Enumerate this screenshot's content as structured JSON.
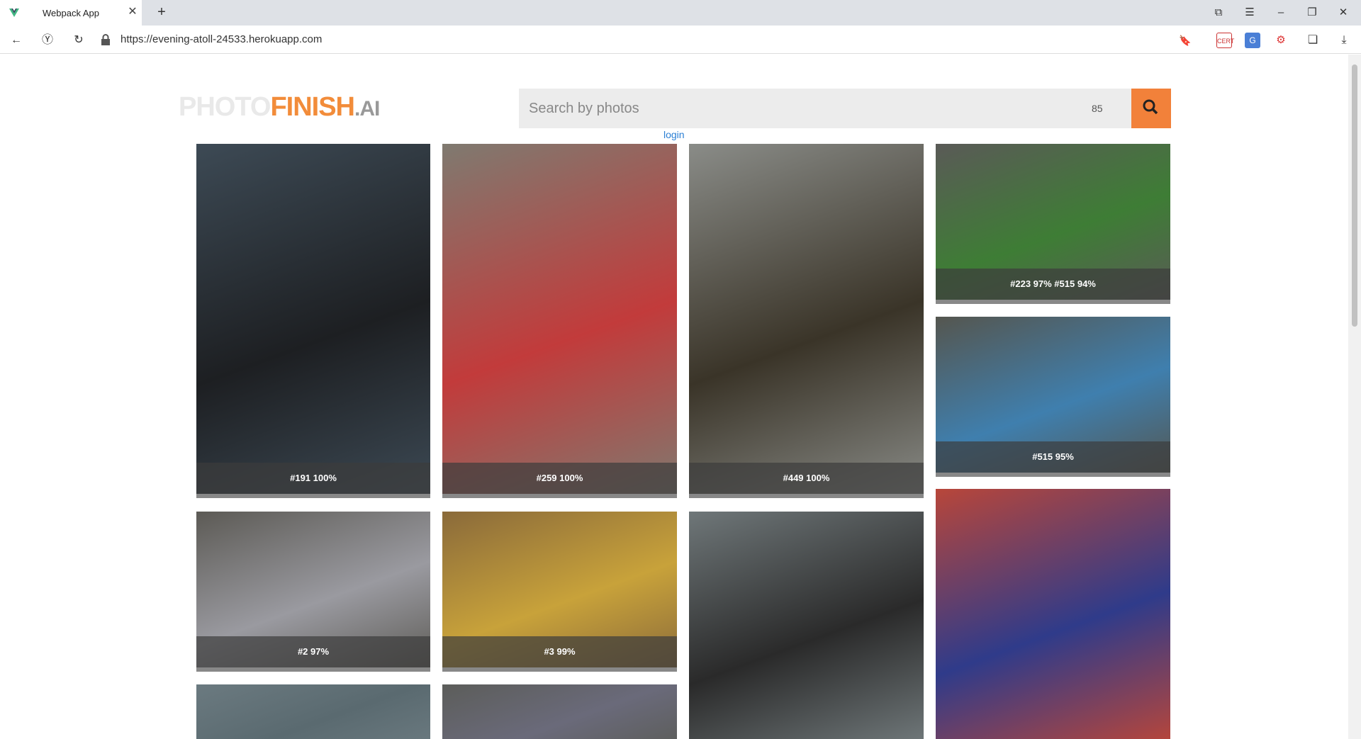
{
  "browser": {
    "tab_title": "Webpack App",
    "url": "https://evening-atoll-24533.herokuapp.com",
    "ext_label_1": "CERT"
  },
  "header": {
    "logo_photo": "PHOTO",
    "logo_finish": "FINISH",
    "logo_ai": ".AI",
    "search_placeholder": "Search by photos",
    "search_count": "85",
    "login": "login"
  },
  "photos": [
    {
      "label": "#191 100%",
      "bg": "#3d4a55",
      "accent": "#1d1f22"
    },
    {
      "label": "#259 100%",
      "bg": "#7f7a70",
      "accent": "#c23b3b"
    },
    {
      "label": "#449 100%",
      "bg": "#8a8c88",
      "accent": "#3a3428"
    },
    {
      "label": "#223 97% #515 94%",
      "bg": "#5a5a57",
      "accent": "#3e7d35"
    },
    {
      "label": "#515 95%",
      "bg": "#55564f",
      "accent": "#3f7fae"
    },
    {
      "label": "#2 97%",
      "bg": "#5c5a55",
      "accent": "#9a9aa0"
    },
    {
      "label": "#3 99%",
      "bg": "#8a6a3a",
      "accent": "#c8a23a"
    },
    {
      "label": "",
      "bg": "#6f7779",
      "accent": "#2a2a2a"
    },
    {
      "label": "",
      "bg": "#b8463a",
      "accent": "#2f3b8a"
    },
    {
      "label": "",
      "bg": "#6b7a80",
      "accent": "#5a6a70"
    },
    {
      "label": "",
      "bg": "#5c5d5a",
      "accent": "#6a6a7a"
    }
  ]
}
